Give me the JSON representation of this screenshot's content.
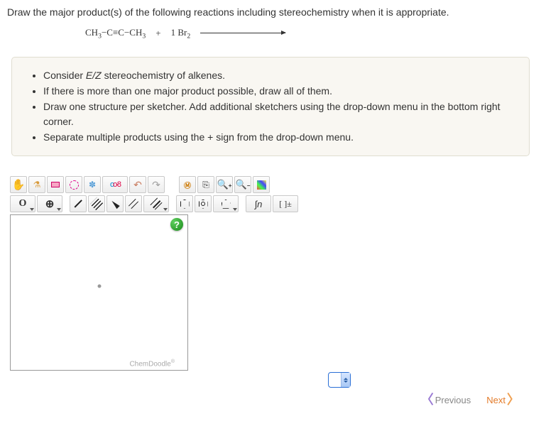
{
  "question": "Draw the major product(s) of the following reactions including stereochemistry when it is appropriate.",
  "reaction": {
    "reactant": "CH₃−C≡C−CH₃",
    "plus": "+",
    "reagent": "1 Br₂"
  },
  "hints": [
    {
      "pre": "Consider ",
      "em": "E/Z",
      "post": " stereochemistry of alkenes."
    },
    {
      "pre": "If there is more than one major product possible, draw all of them.",
      "em": "",
      "post": ""
    },
    {
      "pre": "Draw one structure per sketcher. Add additional sketchers using the drop-down menu in the bottom right corner.",
      "em": "",
      "post": ""
    },
    {
      "pre": "Separate multiple products using the + sign from the drop-down menu.",
      "em": "",
      "post": ""
    }
  ],
  "toolbar": {
    "row1": [
      "hand",
      "flask",
      "eraser",
      "lasso",
      "snowflake",
      "atom-pair",
      "undo",
      "redo",
      "spacer",
      "chemdraw-icon",
      "copy",
      "zoom-in",
      "zoom-out",
      "color"
    ],
    "row2_atom": "O",
    "row2_plus": "⊕",
    "row2_curvedn": "∫n",
    "row2_bracket": "[ ]±"
  },
  "sketcher": {
    "help": "?",
    "brand": "ChemDoodle",
    "brand_sup": "®"
  },
  "nav": {
    "prev": "Previous",
    "next": "Next"
  }
}
